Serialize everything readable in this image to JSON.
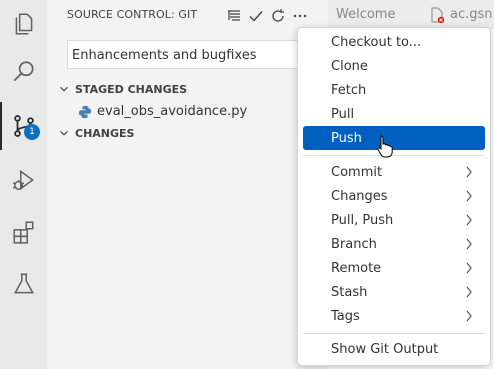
{
  "activity_bar": {
    "scm_badge": "1"
  },
  "sidebar": {
    "title": "SOURCE CONTROL: GIT",
    "commit_message": "Enhancements and bugfixes",
    "staged_header": "STAGED CHANGES",
    "staged_file": "eval_obs_avoidance.py",
    "changes_header": "CHANGES"
  },
  "tabs": [
    {
      "label": "Welcome"
    },
    {
      "label": "ac.gsn"
    }
  ],
  "menu": {
    "items": [
      {
        "label": "Checkout to..."
      },
      {
        "label": "Clone"
      },
      {
        "label": "Fetch"
      },
      {
        "label": "Pull"
      },
      {
        "label": "Push"
      },
      {
        "label": "Commit"
      },
      {
        "label": "Changes"
      },
      {
        "label": "Pull, Push"
      },
      {
        "label": "Branch"
      },
      {
        "label": "Remote"
      },
      {
        "label": "Stash"
      },
      {
        "label": "Tags"
      },
      {
        "label": "Show Git Output"
      }
    ],
    "highlighted": "Push"
  },
  "colors": {
    "accent": "#0060c0",
    "badge": "#0e70c0",
    "error": "#e51400",
    "python_icon": "#4a7fb5"
  }
}
